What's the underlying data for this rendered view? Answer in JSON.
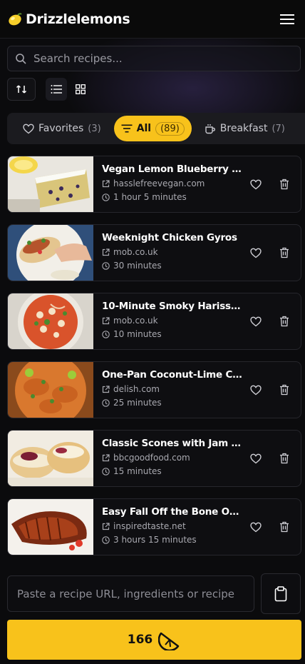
{
  "app": {
    "name": "Drizzlelemons"
  },
  "search": {
    "placeholder": "Search recipes..."
  },
  "filters": [
    {
      "label": "Favorites",
      "count": "(3)",
      "icon": "heart-icon",
      "active": false
    },
    {
      "label": "All",
      "count": "(89)",
      "icon": "filter-icon",
      "active": true
    },
    {
      "label": "Breakfast",
      "count": "(7)",
      "icon": "coffee-icon",
      "active": false
    }
  ],
  "recipes": [
    {
      "title": "Vegan Lemon Blueberry Cake",
      "source": "hasslefreevegan.com",
      "time": "1 hour 5 minutes"
    },
    {
      "title": "Weeknight Chicken Gyros",
      "source": "mob.co.uk",
      "time": "30 minutes"
    },
    {
      "title": "10-Minute Smoky Harissa Cr...",
      "source": "mob.co.uk",
      "time": "10 minutes"
    },
    {
      "title": "One-Pan Coconut-Lime Chi...",
      "source": "delish.com",
      "time": "25 minutes"
    },
    {
      "title": "Classic Scones with Jam & ...",
      "source": "bbcgoodfood.com",
      "time": "15 minutes"
    },
    {
      "title": "Easy Fall Off the Bone Oven ...",
      "source": "inspiredtaste.net",
      "time": "3 hours 15 minutes"
    }
  ],
  "paste": {
    "placeholder": "Paste a recipe URL, ingredients or recipe"
  },
  "cta": {
    "count": "166"
  },
  "colors": {
    "accent": "#f8c21b",
    "background": "#0b0b0d",
    "card": "#0e0e11"
  }
}
